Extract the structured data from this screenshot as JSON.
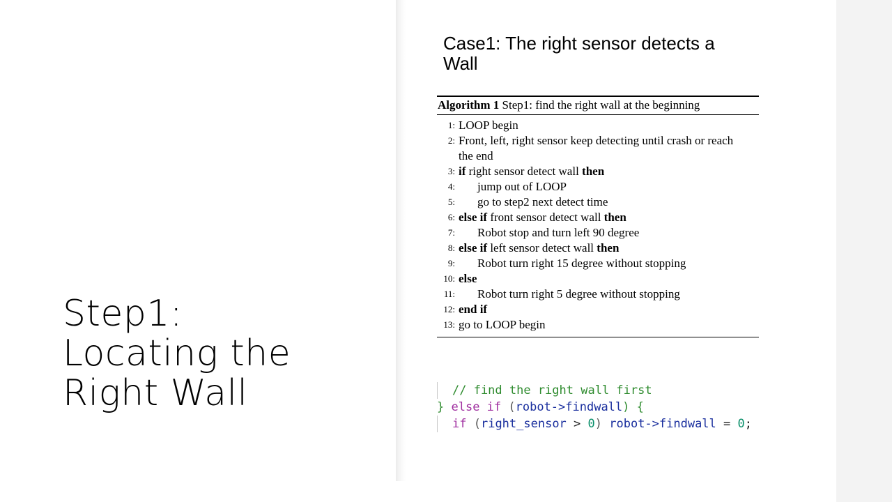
{
  "slide": {
    "title_lines": [
      "Step1:",
      "Locating the",
      "Right Wall"
    ],
    "case_title_lines": [
      "Case1: The right sensor detects a",
      "Wall"
    ]
  },
  "algorithm": {
    "label": "Algorithm 1",
    "caption": "Step1: find the right wall at the beginning",
    "lines": [
      {
        "num": "1:",
        "parts": [
          {
            "t": "LOOP begin"
          }
        ]
      },
      {
        "num": "2:",
        "parts": [
          {
            "t": "Front, left, right sensor keep detecting until crash or reach"
          }
        ]
      },
      {
        "num": "",
        "parts": [
          {
            "t": "the end"
          }
        ]
      },
      {
        "num": "3:",
        "parts": [
          {
            "t": "if",
            "b": true
          },
          {
            "t": " right sensor detect wall "
          },
          {
            "t": "then",
            "b": true
          }
        ]
      },
      {
        "num": "4:",
        "indent": true,
        "parts": [
          {
            "t": "jump out of LOOP"
          }
        ]
      },
      {
        "num": "5:",
        "indent": true,
        "parts": [
          {
            "t": "go to step2 next detect time"
          }
        ]
      },
      {
        "num": "6:",
        "parts": [
          {
            "t": "else if",
            "b": true
          },
          {
            "t": " front sensor detect wall "
          },
          {
            "t": "then",
            "b": true
          }
        ]
      },
      {
        "num": "7:",
        "indent": true,
        "parts": [
          {
            "t": "Robot stop and turn left 90 degree"
          }
        ]
      },
      {
        "num": "8:",
        "parts": [
          {
            "t": "else if",
            "b": true
          },
          {
            "t": " left sensor detect wall "
          },
          {
            "t": "then",
            "b": true
          }
        ]
      },
      {
        "num": "9:",
        "indent": true,
        "parts": [
          {
            "t": "Robot turn right 15 degree without stopping"
          }
        ]
      },
      {
        "num": "10:",
        "parts": [
          {
            "t": "else",
            "b": true
          }
        ]
      },
      {
        "num": "11:",
        "indent": true,
        "parts": [
          {
            "t": "Robot turn right 5 degree without stopping"
          }
        ]
      },
      {
        "num": "12:",
        "parts": [
          {
            "t": "end if",
            "b": true
          }
        ]
      },
      {
        "num": "13:",
        "parts": [
          {
            "t": "go to LOOP begin"
          }
        ]
      }
    ]
  },
  "code": {
    "lines": [
      {
        "bar": true,
        "tokens": [
          {
            "t": "// find the right wall first",
            "c": "c-comment"
          }
        ]
      },
      {
        "bar": false,
        "tokens": [
          {
            "t": "} ",
            "c": "c-comment"
          },
          {
            "t": "else if",
            "c": "c-kw"
          },
          {
            "t": " (",
            "c": "c-paren"
          },
          {
            "t": "robot->findwall",
            "c": "c-id"
          },
          {
            "t": ") {",
            "c": "c-comment"
          }
        ]
      },
      {
        "bar": true,
        "tokens": [
          {
            "t": "if",
            "c": "c-kw"
          },
          {
            "t": " (",
            "c": "c-paren"
          },
          {
            "t": "right_sensor",
            "c": "c-id"
          },
          {
            "t": " > ",
            "c": "c-op"
          },
          {
            "t": "0",
            "c": "c-num"
          },
          {
            "t": ") ",
            "c": "c-paren"
          },
          {
            "t": "robot->findwall",
            "c": "c-id"
          },
          {
            "t": " = ",
            "c": "c-op"
          },
          {
            "t": "0",
            "c": "c-num"
          },
          {
            "t": ";",
            "c": "c-op"
          }
        ]
      }
    ]
  }
}
